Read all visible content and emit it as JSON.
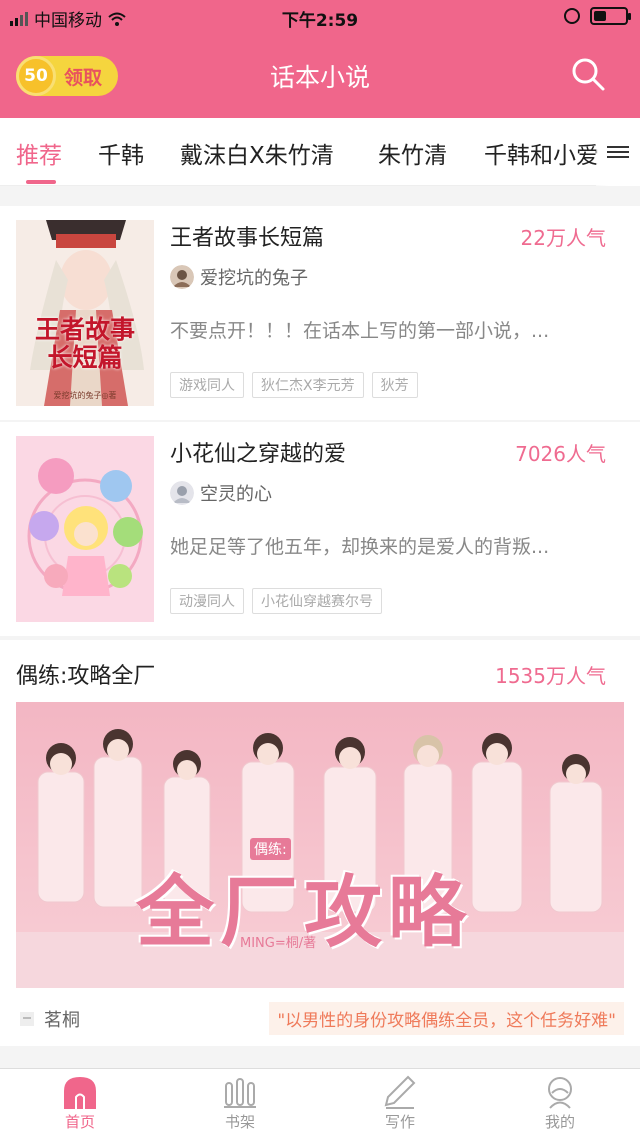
{
  "status_bar": {
    "carrier": "中国移动",
    "time": "下午2:59"
  },
  "header": {
    "coins": "50",
    "claim_label": "领取",
    "title": "话本小说"
  },
  "tabs": [
    {
      "label": "推荐"
    },
    {
      "label": "千韩"
    },
    {
      "label": "戴沫白X朱竹清"
    },
    {
      "label": "朱竹清"
    },
    {
      "label": "千韩和小爱"
    }
  ],
  "books": [
    {
      "title": "王者故事长短篇",
      "popularity": "22万人气",
      "author": "爱挖坑的兔子",
      "description": "不要点开！！！在话本上写的第一部小说，...",
      "tags": [
        "游戏同人",
        "狄仁杰X李元芳",
        "狄芳"
      ],
      "cover_text": [
        "王者故事",
        "长短篇"
      ],
      "cover_sub": "爱挖坑的兔子◎著"
    },
    {
      "title": "小花仙之穿越的爱",
      "popularity": "7026人气",
      "author": "空灵的心",
      "description": "她足足等了他五年，却换来的是爱人的背叛...",
      "tags": [
        "动漫同人",
        "小花仙穿越赛尔号"
      ]
    }
  ],
  "featured": {
    "title": "偶练:攻略全厂",
    "popularity": "1535万人气",
    "banner_text": "全厂攻略",
    "banner_small": "偶练:",
    "banner_credit": "MING=桐/著",
    "author": "茗桐",
    "quote": "\"以男性的身份攻略偶练全员，这个任务好难\""
  },
  "bottom_nav": [
    {
      "label": "首页",
      "icon": "home-icon",
      "active": true
    },
    {
      "label": "书架",
      "icon": "bookshelf-icon",
      "active": false
    },
    {
      "label": "写作",
      "icon": "pen-icon",
      "active": false
    },
    {
      "label": "我的",
      "icon": "profile-icon",
      "active": false
    }
  ],
  "colors": {
    "brand": "#f0668b",
    "popularity": "#ef6b90",
    "coin": "#f5d53e"
  }
}
